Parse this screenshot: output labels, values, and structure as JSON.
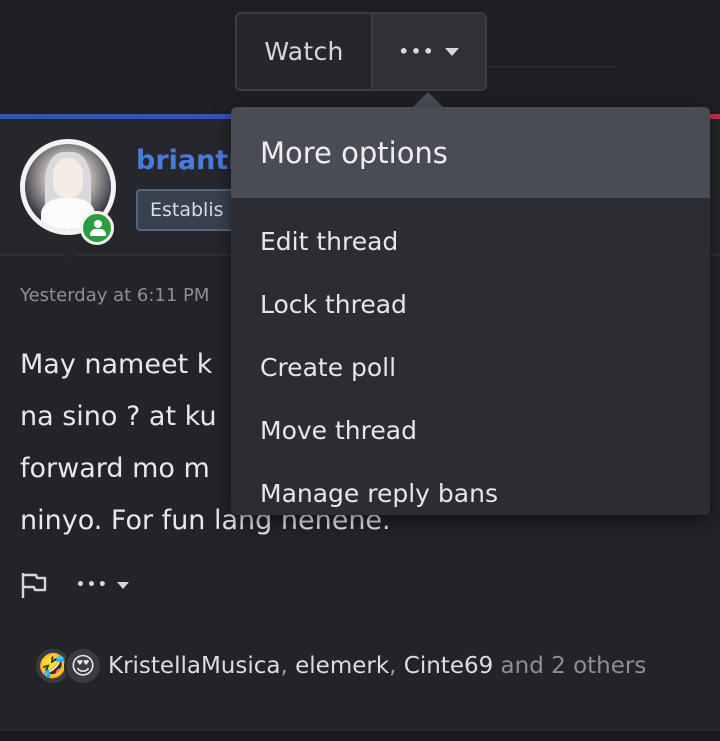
{
  "toolbar": {
    "watch_label": "Watch",
    "more_label": "•••"
  },
  "post": {
    "username": "briantr",
    "user_title": "Establis",
    "timestamp": "Yesterday at 6:11 PM",
    "message_lines": [
      "May nameet k",
      "na sino ? at ku",
      "forward mo m",
      "ninyo. For fun lang hehehe."
    ],
    "actions": {
      "more_label": "•••"
    },
    "reactions": {
      "icons": [
        "rolling-laughing-emoji",
        "heart-eyes-emoji"
      ],
      "users": [
        "KristellaMusica",
        "elemerk",
        "Cinte69"
      ],
      "separator": ", ",
      "others": " and 2 others"
    }
  },
  "menu": {
    "title": "More options",
    "items": [
      {
        "label": "Edit thread"
      },
      {
        "label": "Lock thread"
      },
      {
        "label": "Create poll"
      },
      {
        "label": "Move thread"
      },
      {
        "label": "Manage reply bans"
      }
    ]
  }
}
